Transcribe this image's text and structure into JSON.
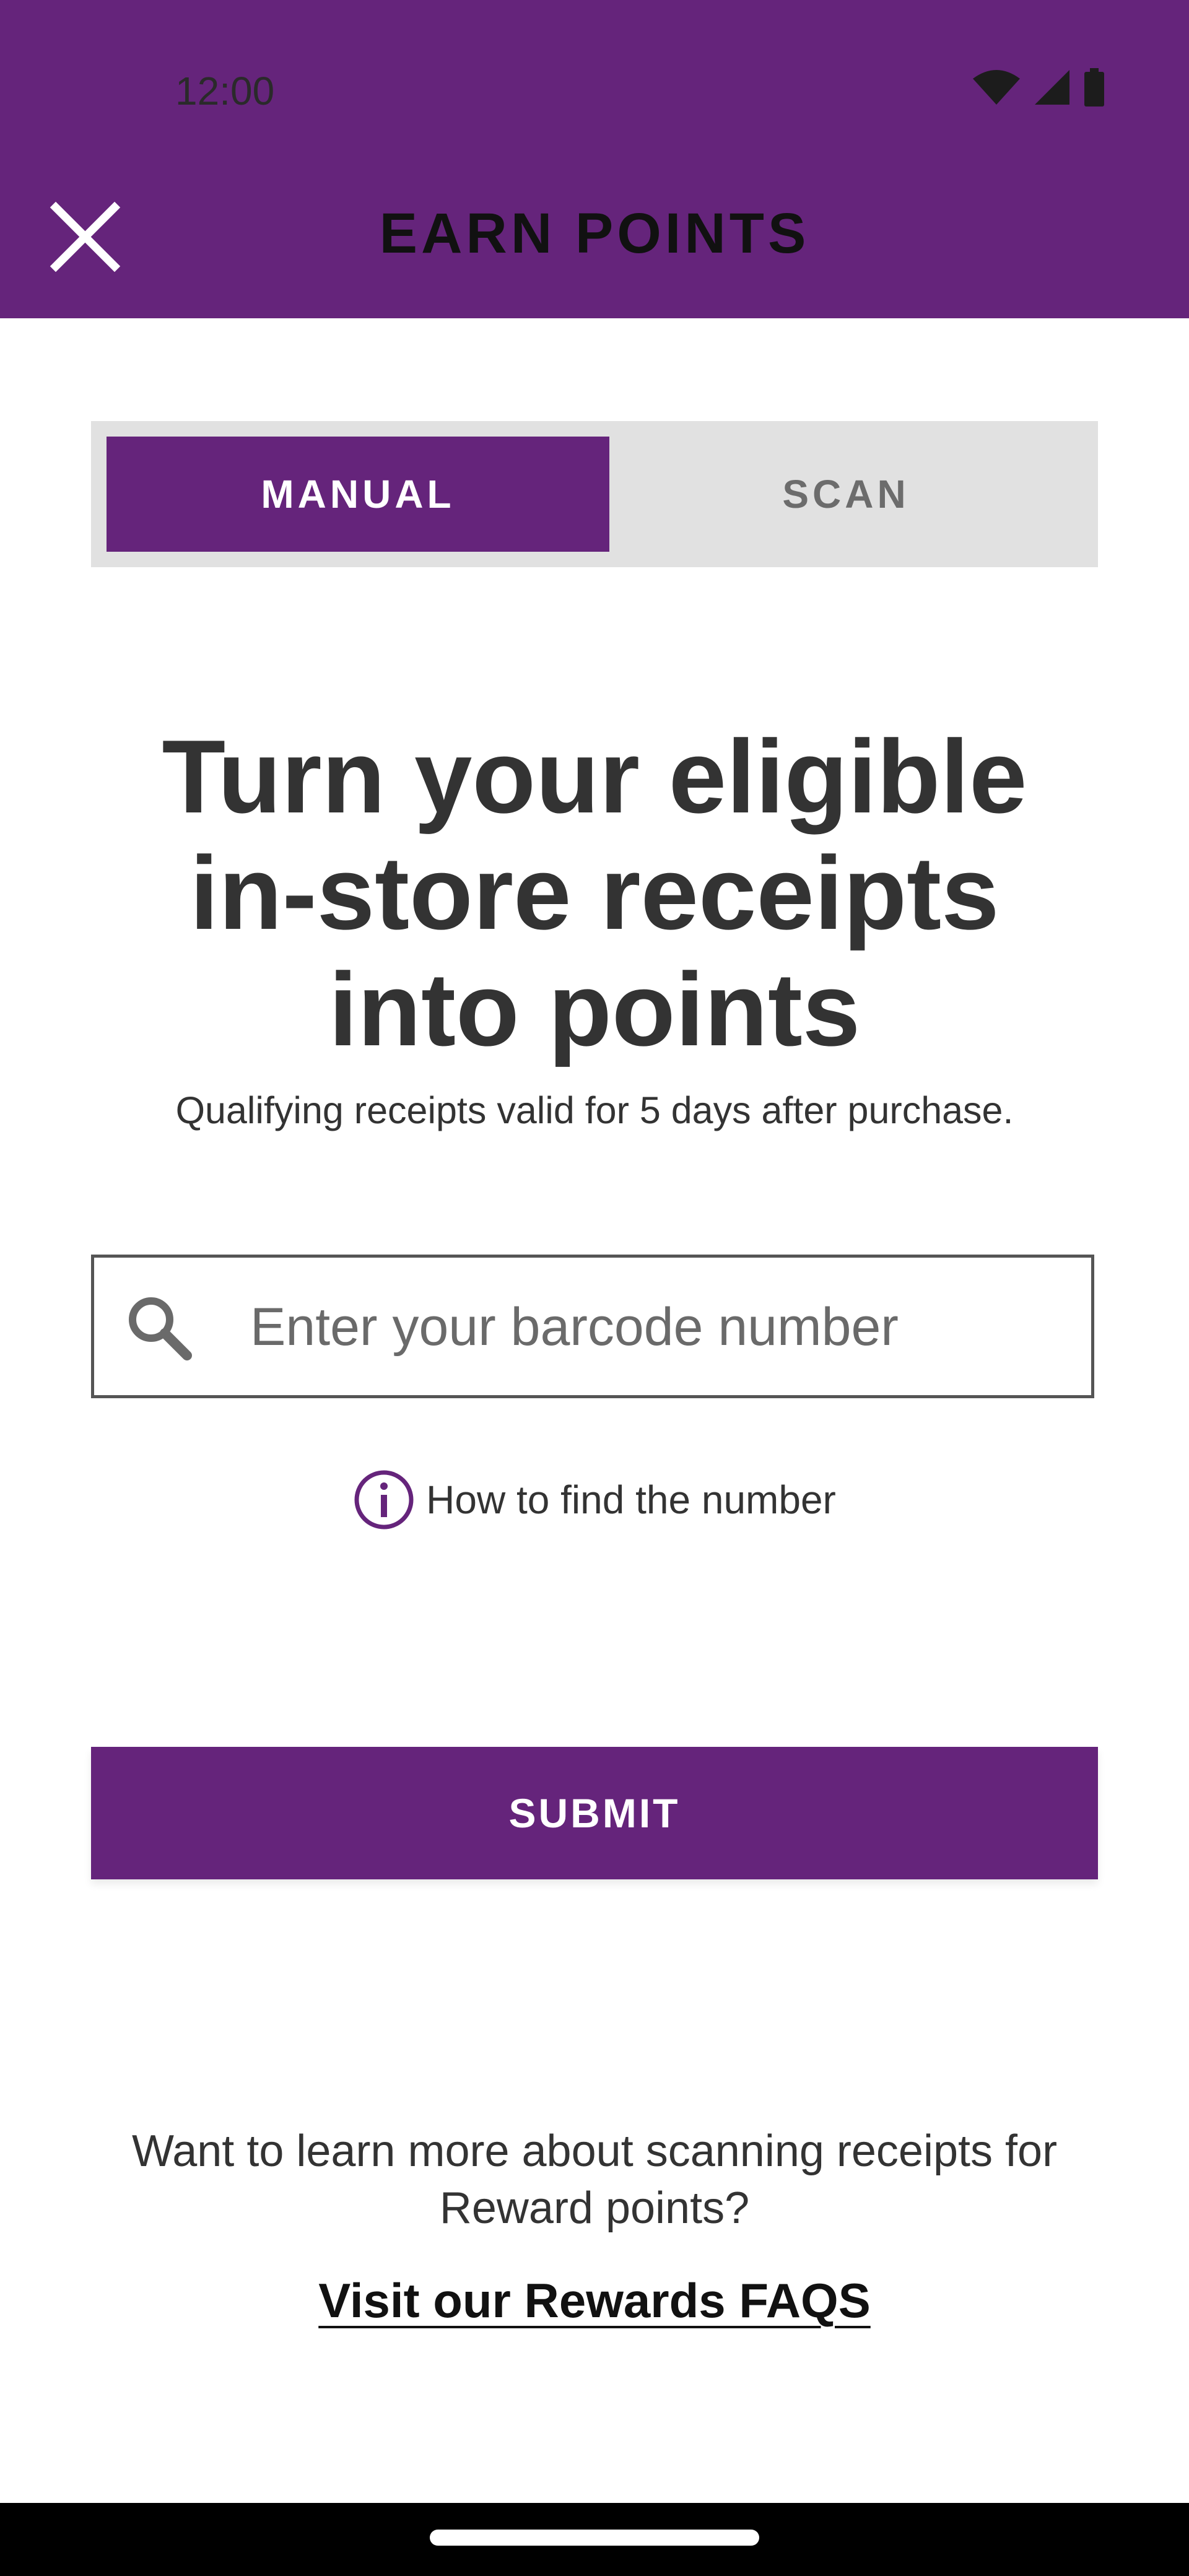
{
  "status_bar": {
    "time": "12:00"
  },
  "header": {
    "title": "EARN POINTS"
  },
  "tabs": [
    {
      "label": "MANUAL",
      "selected": true
    },
    {
      "label": "SCAN",
      "selected": false
    }
  ],
  "headline": "Turn your eligible in-store receipts into points",
  "subline": "Qualifying receipts valid for 5 days after purchase.",
  "search": {
    "placeholder": "Enter your barcode number",
    "value": ""
  },
  "help": {
    "label": "How to find the number"
  },
  "submit": {
    "label": "SUBMIT"
  },
  "footer": {
    "learn_more": "Want to learn more about scanning receipts for Reward points?",
    "faq_link": "Visit our Rewards FAQS"
  },
  "colors": {
    "brand": "#65247b",
    "tab_track": "#e1e1e1",
    "text": "#333333"
  },
  "icons": {
    "close": "close-icon",
    "search": "search-icon",
    "info": "info-icon",
    "wifi": "wifi-icon",
    "signal": "signal-icon",
    "battery": "battery-icon"
  }
}
